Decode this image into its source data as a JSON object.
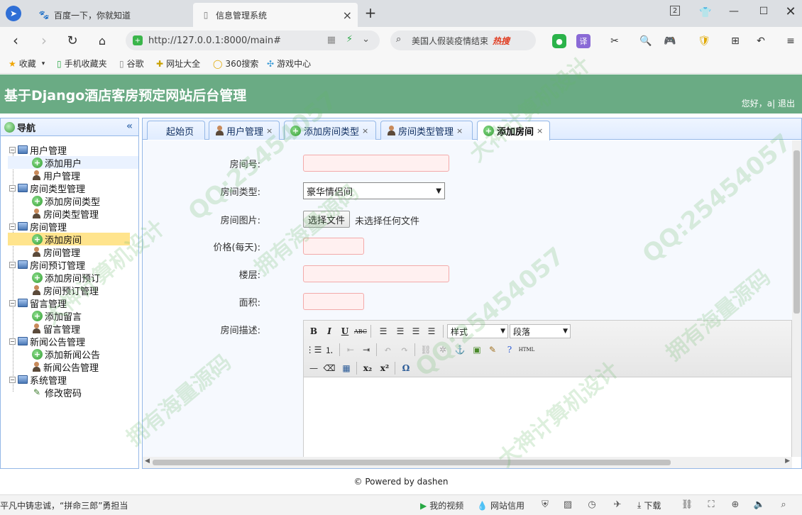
{
  "browser": {
    "tabs": [
      {
        "label": "百度一下，你就知道",
        "active": false
      },
      {
        "label": "信息管理系统",
        "active": true
      }
    ],
    "new_tab": "+",
    "tab_count": "2",
    "url": "http://127.0.0.1:8000/main#",
    "search_text": "美国人假装疫情结束",
    "search_hot": "热搜",
    "bookmarks": [
      "收藏",
      "手机收藏夹",
      "谷歌",
      "网址大全",
      "360搜索",
      "游戏中心"
    ]
  },
  "app": {
    "title": "基于Django酒店客房预定网站后台管理",
    "greeting": "您好，a|",
    "logout": "退出"
  },
  "sidebar": {
    "title": "导航",
    "groups": [
      {
        "label": "用户管理",
        "items": [
          "添加用户",
          "用户管理"
        ]
      },
      {
        "label": "房间类型管理",
        "items": [
          "添加房间类型",
          "房间类型管理"
        ]
      },
      {
        "label": "房间管理",
        "items": [
          "添加房间",
          "房间管理"
        ]
      },
      {
        "label": "房间预订管理",
        "items": [
          "添加房间预订",
          "房间预订管理"
        ]
      },
      {
        "label": "留言管理",
        "items": [
          "添加留言",
          "留言管理"
        ]
      },
      {
        "label": "新闻公告管理",
        "items": [
          "添加新闻公告",
          "新闻公告管理"
        ]
      },
      {
        "label": "系统管理",
        "items": [
          "修改密码"
        ]
      }
    ],
    "selected": "添加房间"
  },
  "tabs": [
    {
      "label": "起始页",
      "closable": false
    },
    {
      "label": "用户管理",
      "closable": true
    },
    {
      "label": "添加房间类型",
      "closable": true
    },
    {
      "label": "房间类型管理",
      "closable": true
    },
    {
      "label": "添加房间",
      "closable": true,
      "active": true
    }
  ],
  "form": {
    "room_no_label": "房间号:",
    "room_type_label": "房间类型:",
    "room_type_value": "豪华情侣间",
    "room_image_label": "房间图片:",
    "choose_file": "选择文件",
    "no_file": "未选择任何文件",
    "price_label": "价格(每天):",
    "floor_label": "楼层:",
    "area_label": "面积:",
    "description_label": "房间描述:"
  },
  "editor": {
    "style_select": "样式",
    "paragraph_select": "段落",
    "html_btn": "HTML"
  },
  "footer": "© Powered by dashen",
  "status": {
    "news": "平凡中铸忠诚，“拼命三郎”勇担当",
    "video": "我的视频",
    "credit": "网站信用",
    "download": "下载"
  },
  "watermarks": [
    "QQ:25454057",
    "拥有海量源码",
    "大神计算机设计",
    "QQ:25454057",
    "拥有海量源码",
    "大神计算机设计",
    "QQ:25454057",
    "拥有海量源码",
    "大神计算机设计"
  ]
}
